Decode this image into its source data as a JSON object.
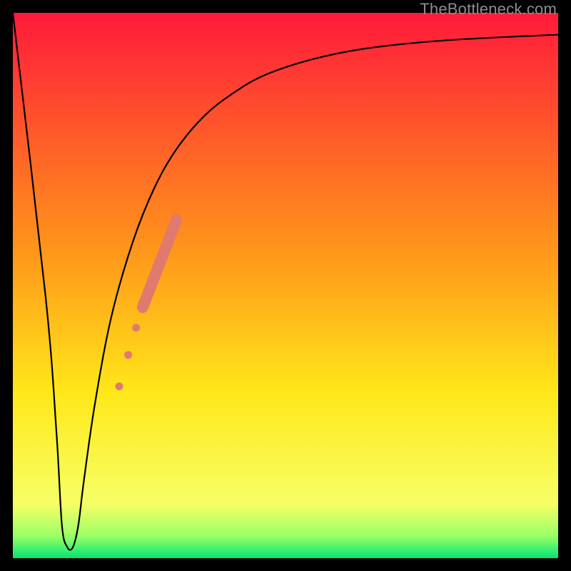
{
  "watermark": "TheBottleneck.com",
  "chart_data": {
    "type": "line",
    "title": "",
    "xlabel": "",
    "ylabel": "",
    "xlim": [
      0,
      100
    ],
    "ylim": [
      0,
      100
    ],
    "grid": false,
    "legend": false,
    "background_gradient": {
      "stops": [
        {
          "pos": 0.0,
          "color": "#ff1a3a"
        },
        {
          "pos": 0.45,
          "color": "#ff9a1a"
        },
        {
          "pos": 0.7,
          "color": "#ffe81a"
        },
        {
          "pos": 0.9,
          "color": "#f7ff66"
        },
        {
          "pos": 0.96,
          "color": "#9aff66"
        },
        {
          "pos": 1.0,
          "color": "#00e676"
        }
      ]
    },
    "series": [
      {
        "name": "bottleneck-curve",
        "stroke": "#000000",
        "stroke_width": 2.2,
        "x": [
          0.0,
          6.0,
          8.0,
          9.0,
          10.0,
          11.0,
          12.0,
          13.0,
          15.0,
          18.0,
          22.0,
          26.0,
          30.0,
          35.0,
          40.0,
          46.0,
          55.0,
          65.0,
          80.0,
          100.0
        ],
        "y": [
          100.0,
          48.0,
          23.0,
          6.0,
          2.0,
          2.0,
          6.0,
          14.0,
          28.0,
          44.0,
          58.0,
          68.0,
          75.0,
          81.0,
          85.0,
          88.5,
          91.5,
          93.5,
          95.0,
          96.0
        ]
      }
    ],
    "highlight_segment": {
      "name": "highlighted-range",
      "color": "#e07a6f",
      "parts": [
        {
          "x1": 19.0,
          "y1": 30.0,
          "x2": 20.0,
          "y2": 33.0,
          "r": 5.5
        },
        {
          "x1": 20.8,
          "y1": 36.0,
          "x2": 21.5,
          "y2": 38.5,
          "r": 5.5
        },
        {
          "x1": 22.2,
          "y1": 41.0,
          "x2": 23.0,
          "y2": 43.5,
          "r": 5.5
        },
        {
          "x1": 23.8,
          "y1": 46.0,
          "x2": 30.0,
          "y2": 62.0,
          "r": 8.0
        }
      ]
    },
    "valley_flat": {
      "x1": 9.0,
      "x2": 11.0,
      "y": 2.0
    }
  }
}
